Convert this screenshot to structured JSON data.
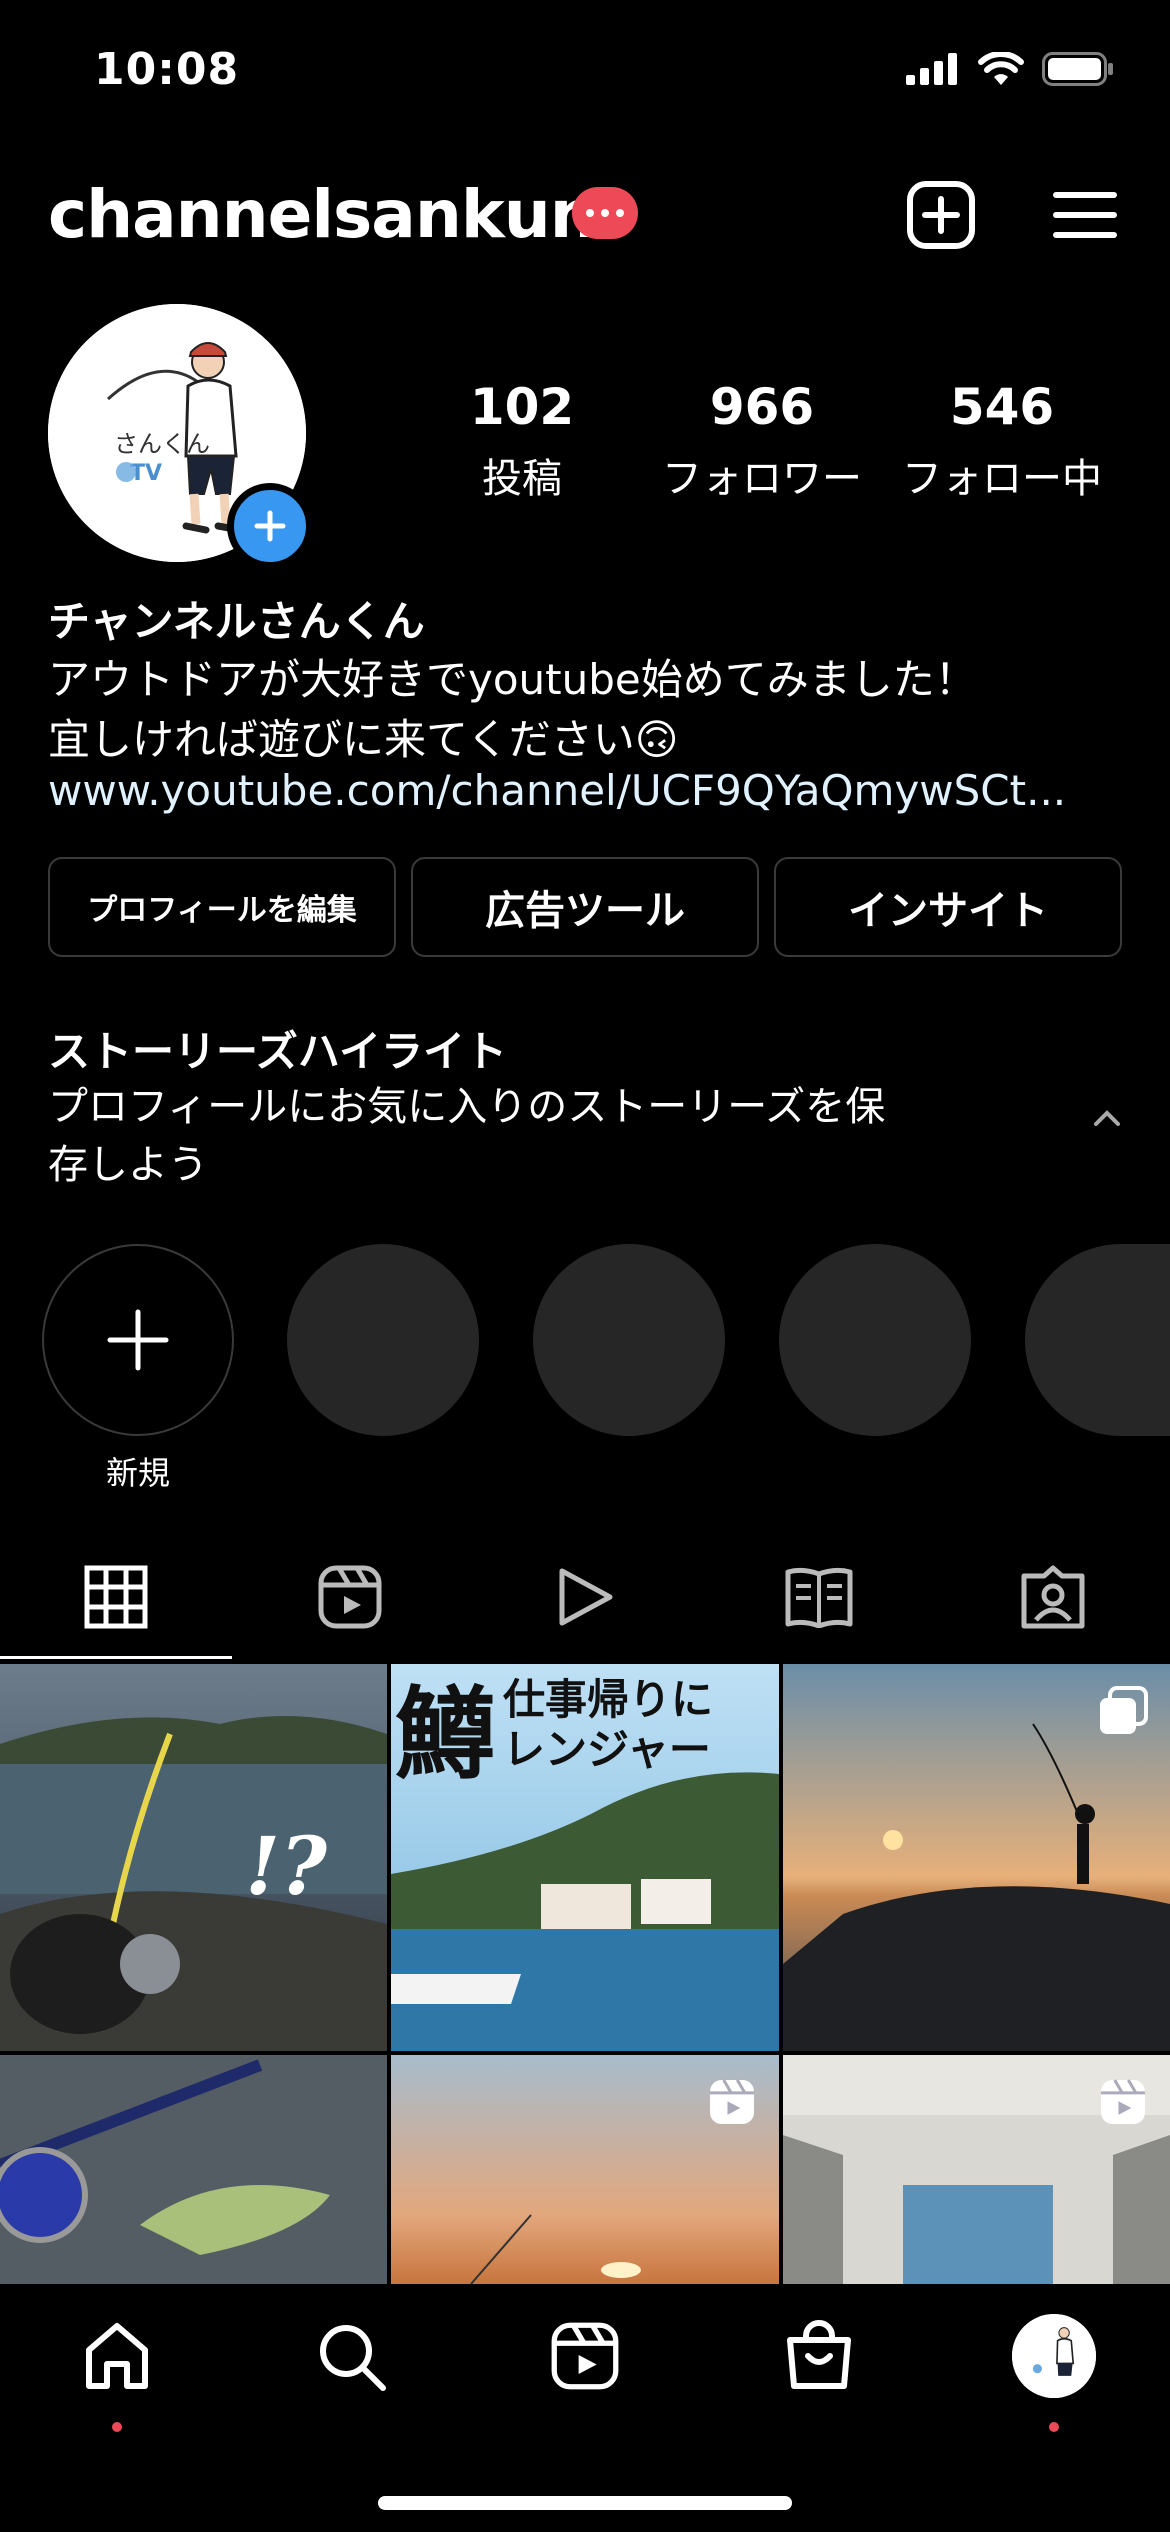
{
  "status_bar": {
    "time": "10:08"
  },
  "header": {
    "username": "channelsankun"
  },
  "profile": {
    "avatar_text": "さんくん TV",
    "stats": [
      {
        "count": "102",
        "label": "投稿"
      },
      {
        "count": "966",
        "label": "フォロワー"
      },
      {
        "count": "546",
        "label": "フォロー中"
      }
    ],
    "display_name": "チャンネルさんくん",
    "bio_line1": "アウトドアが大好きでyoutube始めてみました！",
    "bio_line2": "宜しければ遊びに来てください🙃",
    "link": "www.youtube.com/channel/UCF9QYaQmywSCt..."
  },
  "buttons": {
    "edit_profile": "プロフィールを編集",
    "ad_tools": "広告ツール",
    "insights": "インサイト"
  },
  "highlights": {
    "title": "ストーリーズハイライト",
    "description": "プロフィールにお気に入りのストーリーズを保存しよう",
    "new_label": "新規"
  },
  "grid": {
    "post1_text": "!?",
    "post2_big": "鱒",
    "post2_line1": "仕事帰りに",
    "post2_line2": "レンジャー"
  },
  "colors": {
    "accent_red": "#ed4956",
    "accent_blue": "#3897f0",
    "background": "#000000",
    "highlight_gray": "#262626"
  },
  "icons": [
    "signal-icon",
    "wifi-icon",
    "battery-icon",
    "plus-square-icon",
    "menu-icon",
    "grid-icon",
    "reels-icon",
    "play-icon",
    "guide-icon",
    "tagged-icon",
    "home-icon",
    "search-icon",
    "shop-icon"
  ]
}
